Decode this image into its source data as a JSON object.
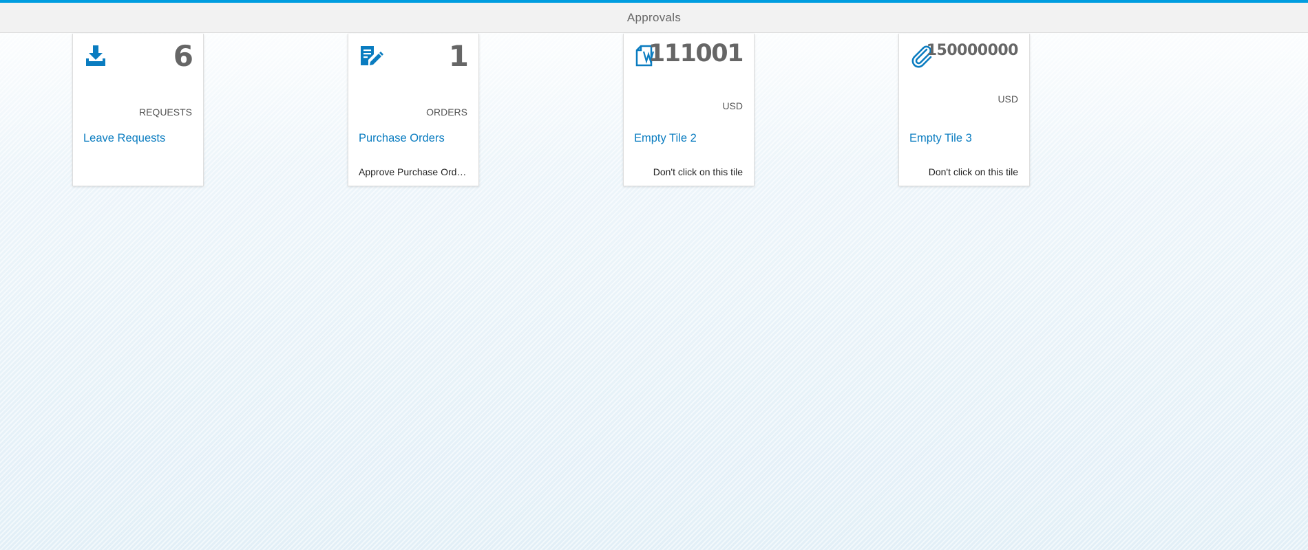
{
  "colors": {
    "accent": "#009de0",
    "icon": "#0a7cc0",
    "link": "#0a7cc0",
    "number": "#666666"
  },
  "header": {
    "title": "Approvals"
  },
  "tiles": [
    {
      "icon": "download-inbox-icon",
      "number": "6",
      "unit": "REQUESTS",
      "title": "Leave Requests",
      "footer": ""
    },
    {
      "icon": "document-edit-icon",
      "number": "1",
      "unit": "ORDERS",
      "title": "Purchase Orders",
      "footer": "Approve Purchase Orders"
    },
    {
      "icon": "word-document-icon",
      "number": "111001",
      "unit": "USD",
      "title": "Empty Tile 2",
      "footer": "Don't click on this tile"
    },
    {
      "icon": "paperclip-icon",
      "number": "150000000",
      "unit": "USD",
      "title": "Empty Tile 3",
      "footer": "Don't click on this tile"
    }
  ]
}
